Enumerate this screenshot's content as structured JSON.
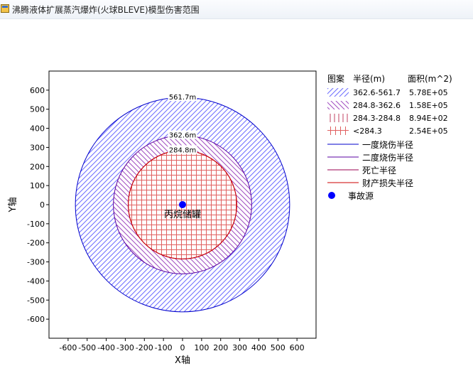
{
  "window": {
    "title": "沸腾液体扩展蒸汽爆炸(火球BLEVE)模型伤害范围"
  },
  "chart_data": {
    "type": "radial-zone-map",
    "xlabel": "X轴",
    "ylabel": "Y轴",
    "xlim": [
      -700,
      700
    ],
    "ylim": [
      -700,
      700
    ],
    "xticks": [
      -600,
      -500,
      -400,
      -300,
      -200,
      -100,
      0,
      100,
      200,
      300,
      400,
      500,
      600
    ],
    "yticks": [
      -600,
      -500,
      -400,
      -300,
      -200,
      -100,
      0,
      100,
      200,
      300,
      400,
      500,
      600
    ],
    "circles": [
      {
        "radius": 561.7,
        "label": "561.7m",
        "color": "#0000cc"
      },
      {
        "radius": 362.6,
        "label": "362.6m",
        "color": "#5a00a0"
      },
      {
        "radius": 284.8,
        "label": "284.8m",
        "color": "#9a0050"
      },
      {
        "radius": 284.3,
        "label": "",
        "color": "#cc0000"
      }
    ],
    "source": {
      "x": 0,
      "y": 0,
      "label": "丙烷储罐",
      "color": "#0000ff"
    },
    "legend": {
      "headers": [
        "图案",
        "半径(m)",
        "面积(m^2)"
      ],
      "zones": [
        {
          "pattern": "diag-forward",
          "range": "362.6-561.7",
          "area": "5.78E+05",
          "color": "#6b6bff"
        },
        {
          "pattern": "diag-back",
          "range": "284.8-362.6",
          "area": "1.58E+05",
          "color": "#a04cc0"
        },
        {
          "pattern": "vertical",
          "range": "284.3-284.8",
          "area": "8.94E+02",
          "color": "#c04060"
        },
        {
          "pattern": "grid",
          "range": "<284.3",
          "area": "2.54E+05",
          "color": "#e06060"
        }
      ],
      "lines": [
        {
          "label": "一度烧伤半径",
          "color": "#0000cc"
        },
        {
          "label": "二度烧伤半径",
          "color": "#5a00a0"
        },
        {
          "label": "死亡半径",
          "color": "#9a0050"
        },
        {
          "label": "财产损失半径",
          "color": "#cc0000"
        }
      ],
      "point": {
        "label": "事故源",
        "color": "#0000ff"
      }
    }
  }
}
